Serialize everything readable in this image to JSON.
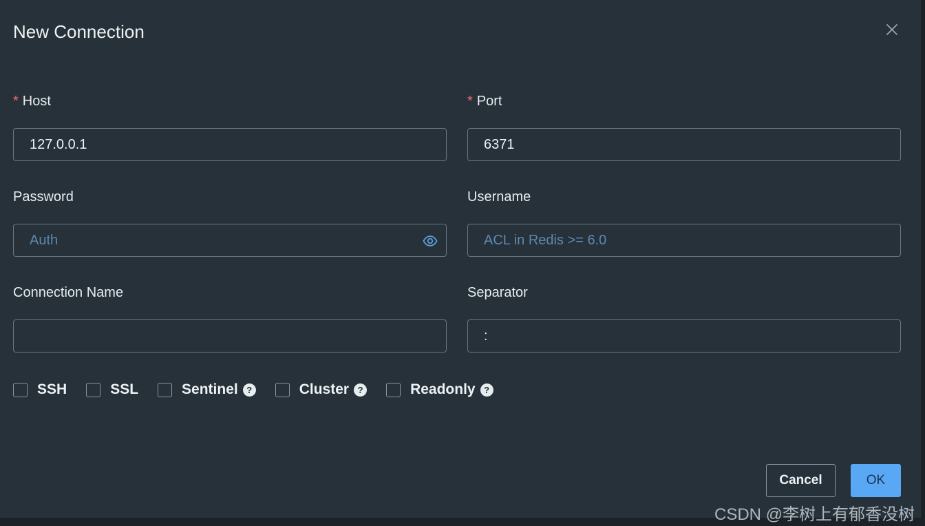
{
  "dialog": {
    "title": "New Connection",
    "close_icon": "close-icon"
  },
  "fields": {
    "host": {
      "label": "Host",
      "required_mark": "*",
      "value": "127.0.0.1",
      "placeholder": ""
    },
    "port": {
      "label": "Port",
      "required_mark": "*",
      "value": "6371",
      "placeholder": ""
    },
    "password": {
      "label": "Password",
      "value": "",
      "placeholder": "Auth",
      "toggle_icon": "eye-icon"
    },
    "username": {
      "label": "Username",
      "value": "",
      "placeholder": "ACL in Redis >= 6.0"
    },
    "connection_name": {
      "label": "Connection Name",
      "value": "",
      "placeholder": ""
    },
    "separator": {
      "label": "Separator",
      "value": ":",
      "placeholder": ""
    }
  },
  "options": [
    {
      "label": "SSH",
      "checked": false,
      "help": false
    },
    {
      "label": "SSL",
      "checked": false,
      "help": false
    },
    {
      "label": "Sentinel",
      "checked": false,
      "help": true
    },
    {
      "label": "Cluster",
      "checked": false,
      "help": true
    },
    {
      "label": "Readonly",
      "checked": false,
      "help": true
    }
  ],
  "help_glyph": "?",
  "buttons": {
    "cancel": "Cancel",
    "ok": "OK"
  },
  "watermark": "CSDN @李树上有郁香没树",
  "colors": {
    "background": "#263139",
    "required": "#f56c6c",
    "placeholder": "#5d88b0",
    "primary": "#59a8f5"
  }
}
